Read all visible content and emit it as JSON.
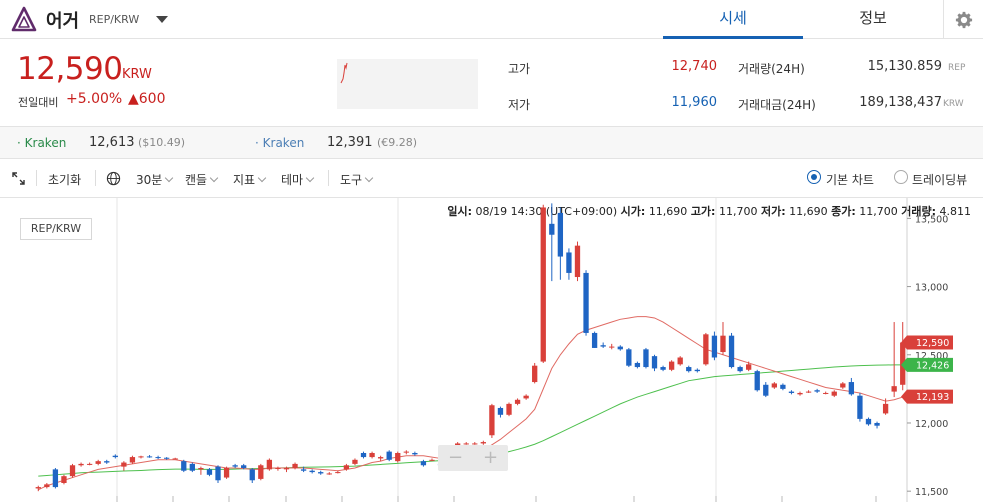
{
  "header": {
    "coin_name": "어거",
    "pair": "REP/KRW",
    "tabs": [
      {
        "label": "시세",
        "active": true
      },
      {
        "label": "정보",
        "active": false
      }
    ]
  },
  "summary": {
    "price": "12,590",
    "price_unit": "KRW",
    "change_label": "전일대비",
    "change_pct": "+5.00%",
    "change_amt": "▲600",
    "high_label": "고가",
    "high_value": "12,740",
    "low_label": "저가",
    "low_value": "11,960",
    "volume_label": "거래량(24H)",
    "volume_value": "15,130.859",
    "volume_unit": "REP",
    "amount_label": "거래대금(24H)",
    "amount_value": "189,138,437",
    "amount_unit": "KRW"
  },
  "exchanges": [
    {
      "name": "Kraken",
      "price": "12,613",
      "sub": "($10.49)"
    },
    {
      "name": "Kraken",
      "price": "12,391",
      "sub": "(€9.28)"
    }
  ],
  "toolbar": {
    "reset": "초기화",
    "interval": "30분",
    "candle": "캔들",
    "indicator": "지표",
    "theme": "테마",
    "tools": "도구",
    "basic_chart": "기본 차트",
    "trading_view": "트레이딩뷰"
  },
  "ohlc_bar": {
    "time_label": "일시:",
    "time_value": "08/19 14:30 (UTC+09:00)",
    "open_label": "시가:",
    "open_value": "11,690",
    "high_label": "고가:",
    "high_value": "11,700",
    "low_label": "저가:",
    "low_value": "11,690",
    "close_label": "종가:",
    "close_value": "11,700",
    "vol_label": "거래량:",
    "vol_value": "4.811"
  },
  "chart_data": {
    "type": "candlestick",
    "pair_label": "REP/KRW",
    "ylim": [
      11450,
      13620
    ],
    "y_ticks": [
      "13,500",
      "13,000",
      "12,500",
      "12,000",
      "11,500"
    ],
    "price_tags": [
      {
        "value": "12,590",
        "y": 12590,
        "color": "#d9403a"
      },
      {
        "value": "12,426",
        "y": 12426,
        "color": "#3cb44a"
      },
      {
        "value": "12,193",
        "y": 12193,
        "color": "#d9403a"
      }
    ],
    "candles": [
      {
        "o": 11520,
        "h": 11540,
        "l": 11500,
        "c": 11530
      },
      {
        "o": 11530,
        "h": 11560,
        "l": 11520,
        "c": 11550
      },
      {
        "o": 11660,
        "h": 11670,
        "l": 11520,
        "c": 11530
      },
      {
        "o": 11560,
        "h": 11620,
        "l": 11550,
        "c": 11610
      },
      {
        "o": 11610,
        "h": 11700,
        "l": 11600,
        "c": 11690
      },
      {
        "o": 11690,
        "h": 11710,
        "l": 11680,
        "c": 11700
      },
      {
        "o": 11700,
        "h": 11710,
        "l": 11690,
        "c": 11700
      },
      {
        "o": 11700,
        "h": 11730,
        "l": 11690,
        "c": 11720
      },
      {
        "o": 11720,
        "h": 11730,
        "l": 11700,
        "c": 11710
      },
      {
        "o": 11760,
        "h": 11770,
        "l": 11740,
        "c": 11750
      },
      {
        "o": 11680,
        "h": 11720,
        "l": 11650,
        "c": 11710
      },
      {
        "o": 11710,
        "h": 11760,
        "l": 11700,
        "c": 11750
      },
      {
        "o": 11750,
        "h": 11760,
        "l": 11740,
        "c": 11755
      },
      {
        "o": 11755,
        "h": 11765,
        "l": 11745,
        "c": 11750
      },
      {
        "o": 11750,
        "h": 11760,
        "l": 11735,
        "c": 11745
      },
      {
        "o": 11745,
        "h": 11750,
        "l": 11730,
        "c": 11740
      },
      {
        "o": 11740,
        "h": 11745,
        "l": 11735,
        "c": 11740
      },
      {
        "o": 11720,
        "h": 11730,
        "l": 11640,
        "c": 11650
      },
      {
        "o": 11700,
        "h": 11710,
        "l": 11640,
        "c": 11650
      },
      {
        "o": 11660,
        "h": 11680,
        "l": 11620,
        "c": 11670
      },
      {
        "o": 11660,
        "h": 11670,
        "l": 11610,
        "c": 11620
      },
      {
        "o": 11680,
        "h": 11690,
        "l": 11560,
        "c": 11580
      },
      {
        "o": 11600,
        "h": 11680,
        "l": 11590,
        "c": 11670
      },
      {
        "o": 11690,
        "h": 11700,
        "l": 11670,
        "c": 11680
      },
      {
        "o": 11690,
        "h": 11700,
        "l": 11660,
        "c": 11670
      },
      {
        "o": 11660,
        "h": 11670,
        "l": 11560,
        "c": 11580
      },
      {
        "o": 11590,
        "h": 11700,
        "l": 11580,
        "c": 11690
      },
      {
        "o": 11660,
        "h": 11740,
        "l": 11650,
        "c": 11730
      },
      {
        "o": 11670,
        "h": 11680,
        "l": 11650,
        "c": 11670
      },
      {
        "o": 11660,
        "h": 11680,
        "l": 11640,
        "c": 11670
      },
      {
        "o": 11670,
        "h": 11710,
        "l": 11660,
        "c": 11700
      },
      {
        "o": 11660,
        "h": 11680,
        "l": 11640,
        "c": 11650
      },
      {
        "o": 11650,
        "h": 11660,
        "l": 11630,
        "c": 11640
      },
      {
        "o": 11640,
        "h": 11650,
        "l": 11620,
        "c": 11630
      },
      {
        "o": 11630,
        "h": 11640,
        "l": 11620,
        "c": 11630
      },
      {
        "o": 11640,
        "h": 11650,
        "l": 11630,
        "c": 11640
      },
      {
        "o": 11660,
        "h": 11700,
        "l": 11650,
        "c": 11690
      },
      {
        "o": 11700,
        "h": 11740,
        "l": 11690,
        "c": 11730
      },
      {
        "o": 11780,
        "h": 11790,
        "l": 11740,
        "c": 11750
      },
      {
        "o": 11750,
        "h": 11790,
        "l": 11740,
        "c": 11780
      },
      {
        "o": 11740,
        "h": 11760,
        "l": 11720,
        "c": 11750
      },
      {
        "o": 11790,
        "h": 11800,
        "l": 11720,
        "c": 11730
      },
      {
        "o": 11720,
        "h": 11790,
        "l": 11710,
        "c": 11780
      },
      {
        "o": 11790,
        "h": 11800,
        "l": 11770,
        "c": 11790
      },
      {
        "o": 11780,
        "h": 11790,
        "l": 11760,
        "c": 11770
      },
      {
        "o": 11720,
        "h": 11730,
        "l": 11680,
        "c": 11690
      },
      {
        "o": 11730,
        "h": 11740,
        "l": 11720,
        "c": 11730
      },
      {
        "o": 11700,
        "h": 11710,
        "l": 11680,
        "c": 11690
      },
      {
        "o": 11720,
        "h": 11730,
        "l": 11700,
        "c": 11710
      },
      {
        "o": 11720,
        "h": 11860,
        "l": 11710,
        "c": 11850
      },
      {
        "o": 11850,
        "h": 11860,
        "l": 11840,
        "c": 11850
      },
      {
        "o": 11850,
        "h": 11860,
        "l": 11840,
        "c": 11850
      },
      {
        "o": 11850,
        "h": 11870,
        "l": 11840,
        "c": 11860
      },
      {
        "o": 11910,
        "h": 12140,
        "l": 11890,
        "c": 12130
      },
      {
        "o": 12110,
        "h": 12120,
        "l": 12040,
        "c": 12060
      },
      {
        "o": 12060,
        "h": 12150,
        "l": 12050,
        "c": 12140
      },
      {
        "o": 12140,
        "h": 12180,
        "l": 12130,
        "c": 12170
      },
      {
        "o": 12180,
        "h": 12210,
        "l": 12170,
        "c": 12200
      },
      {
        "o": 12300,
        "h": 12440,
        "l": 12290,
        "c": 12420
      },
      {
        "o": 12450,
        "h": 13600,
        "l": 12440,
        "c": 13580
      },
      {
        "o": 13460,
        "h": 13610,
        "l": 13040,
        "c": 13380
      },
      {
        "o": 13540,
        "h": 13580,
        "l": 13050,
        "c": 13220
      },
      {
        "o": 13250,
        "h": 13280,
        "l": 13050,
        "c": 13100
      },
      {
        "o": 13070,
        "h": 13330,
        "l": 13040,
        "c": 13300
      },
      {
        "o": 13100,
        "h": 13120,
        "l": 12640,
        "c": 12660
      },
      {
        "o": 12660,
        "h": 12670,
        "l": 12550,
        "c": 12550
      },
      {
        "o": 12570,
        "h": 12590,
        "l": 12550,
        "c": 12560
      },
      {
        "o": 12560,
        "h": 12580,
        "l": 12540,
        "c": 12560
      },
      {
        "o": 12560,
        "h": 12570,
        "l": 12530,
        "c": 12540
      },
      {
        "o": 12540,
        "h": 12550,
        "l": 12410,
        "c": 12420
      },
      {
        "o": 12440,
        "h": 12450,
        "l": 12400,
        "c": 12410
      },
      {
        "o": 12540,
        "h": 12550,
        "l": 12400,
        "c": 12410
      },
      {
        "o": 12490,
        "h": 12500,
        "l": 12380,
        "c": 12400
      },
      {
        "o": 12410,
        "h": 12420,
        "l": 12380,
        "c": 12390
      },
      {
        "o": 12390,
        "h": 12460,
        "l": 12380,
        "c": 12450
      },
      {
        "o": 12430,
        "h": 12490,
        "l": 12420,
        "c": 12480
      },
      {
        "o": 12410,
        "h": 12420,
        "l": 12370,
        "c": 12380
      },
      {
        "o": 12390,
        "h": 12400,
        "l": 12370,
        "c": 12380
      },
      {
        "o": 12430,
        "h": 12660,
        "l": 12420,
        "c": 12650
      },
      {
        "o": 12640,
        "h": 12670,
        "l": 12460,
        "c": 12480
      },
      {
        "o": 12520,
        "h": 12740,
        "l": 12500,
        "c": 12640
      },
      {
        "o": 12640,
        "h": 12660,
        "l": 12400,
        "c": 12410
      },
      {
        "o": 12410,
        "h": 12420,
        "l": 12370,
        "c": 12380
      },
      {
        "o": 12390,
        "h": 12450,
        "l": 12380,
        "c": 12430
      },
      {
        "o": 12380,
        "h": 12390,
        "l": 12230,
        "c": 12240
      },
      {
        "o": 12280,
        "h": 12300,
        "l": 12190,
        "c": 12200
      },
      {
        "o": 12260,
        "h": 12300,
        "l": 12250,
        "c": 12290
      },
      {
        "o": 12280,
        "h": 12290,
        "l": 12240,
        "c": 12250
      },
      {
        "o": 12230,
        "h": 12240,
        "l": 12210,
        "c": 12220
      },
      {
        "o": 12210,
        "h": 12230,
        "l": 12200,
        "c": 12220
      },
      {
        "o": 12230,
        "h": 12240,
        "l": 12220,
        "c": 12230
      },
      {
        "o": 12240,
        "h": 12250,
        "l": 12220,
        "c": 12230
      },
      {
        "o": 12220,
        "h": 12230,
        "l": 12210,
        "c": 12220
      },
      {
        "o": 12200,
        "h": 12240,
        "l": 12190,
        "c": 12230
      },
      {
        "o": 12260,
        "h": 12300,
        "l": 12250,
        "c": 12290
      },
      {
        "o": 12300,
        "h": 12330,
        "l": 12200,
        "c": 12210
      },
      {
        "o": 12200,
        "h": 12220,
        "l": 12010,
        "c": 12030
      },
      {
        "o": 12030,
        "h": 12040,
        "l": 11980,
        "c": 11990
      },
      {
        "o": 12000,
        "h": 12010,
        "l": 11960,
        "c": 11980
      },
      {
        "o": 12070,
        "h": 12180,
        "l": 12060,
        "c": 12140
      },
      {
        "o": 12230,
        "h": 12740,
        "l": 12190,
        "c": 12270
      },
      {
        "o": 12280,
        "h": 12740,
        "l": 12240,
        "c": 12590
      }
    ],
    "ma_short": [
      11510,
      11540,
      11560,
      11580,
      11600,
      11620,
      11640,
      11660,
      11670,
      11680,
      11690,
      11700,
      11710,
      11720,
      11730,
      11730,
      11730,
      11720,
      11710,
      11700,
      11690,
      11680,
      11670,
      11670,
      11665,
      11660,
      11660,
      11670,
      11670,
      11670,
      11670,
      11670,
      11665,
      11660,
      11655,
      11650,
      11660,
      11670,
      11690,
      11710,
      11720,
      11740,
      11750,
      11760,
      11760,
      11760,
      11750,
      11740,
      11730,
      11740,
      11760,
      11780,
      11800,
      11840,
      11880,
      11930,
      11980,
      12030,
      12100,
      12250,
      12400,
      12500,
      12580,
      12650,
      12680,
      12700,
      12720,
      12740,
      12760,
      12770,
      12780,
      12780,
      12770,
      12740,
      12700,
      12660,
      12620,
      12580,
      12540,
      12520,
      12500,
      12480,
      12460,
      12440,
      12420,
      12400,
      12380,
      12360,
      12340,
      12320,
      12300,
      12280,
      12260,
      12250,
      12240,
      12230,
      12220,
      12200,
      12180,
      12160,
      12170,
      12190
    ],
    "ma_long": [
      11610,
      11615,
      11620,
      11625,
      11630,
      11635,
      11638,
      11640,
      11642,
      11645,
      11648,
      11650,
      11652,
      11655,
      11658,
      11660,
      11662,
      11662,
      11662,
      11660,
      11660,
      11660,
      11660,
      11662,
      11664,
      11665,
      11666,
      11668,
      11670,
      11672,
      11674,
      11675,
      11676,
      11677,
      11678,
      11680,
      11682,
      11684,
      11688,
      11692,
      11696,
      11700,
      11704,
      11708,
      11712,
      11716,
      11720,
      11724,
      11728,
      11734,
      11740,
      11746,
      11754,
      11764,
      11776,
      11790,
      11806,
      11824,
      11844,
      11870,
      11900,
      11930,
      11960,
      11990,
      12020,
      12050,
      12080,
      12110,
      12140,
      12165,
      12190,
      12210,
      12230,
      12250,
      12270,
      12290,
      12310,
      12320,
      12330,
      12340,
      12345,
      12350,
      12355,
      12360,
      12365,
      12370,
      12375,
      12380,
      12385,
      12390,
      12395,
      12400,
      12405,
      12410,
      12414,
      12418,
      12420,
      12422,
      12424,
      12425,
      12426,
      12426
    ]
  }
}
